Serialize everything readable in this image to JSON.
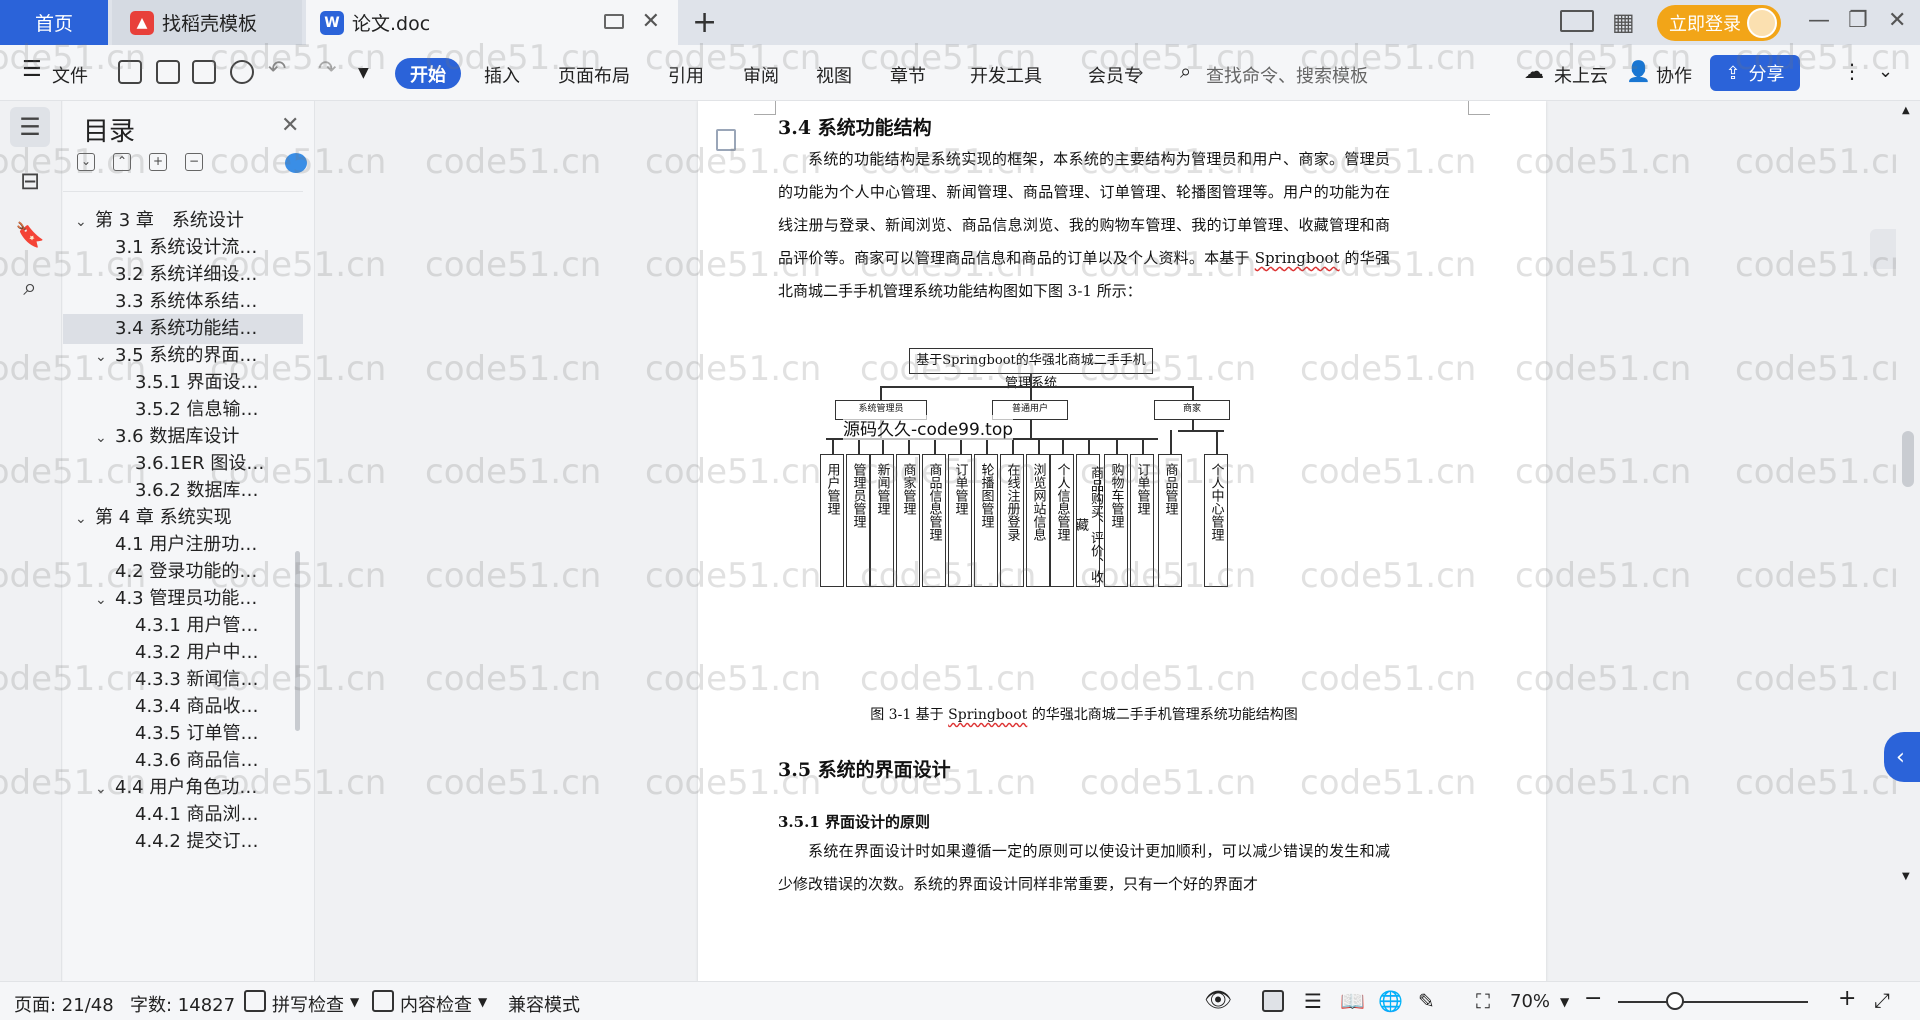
{
  "tabs": {
    "home": "首页",
    "template": "找稻壳模板",
    "document": "论文.doc",
    "new_tab": "+"
  },
  "titlebar": {
    "login": "立即登录"
  },
  "ribbon": {
    "file": "文件",
    "start": "开始",
    "insert": "插入",
    "layout": "页面布局",
    "reference": "引用",
    "review": "审阅",
    "view": "视图",
    "chapter": "章节",
    "devtools": "开发工具",
    "member": "会员专",
    "search_placeholder": "查找命令、搜索模板",
    "cloud": "未上云",
    "collab": "协作",
    "share": "分享"
  },
  "toc": {
    "title": "目录",
    "items": [
      {
        "label": "第 3 章　系统设计",
        "level": 0,
        "expanded": true
      },
      {
        "label": "3.1 系统设计流…",
        "level": 1
      },
      {
        "label": "3.2 系统详细设…",
        "level": 1
      },
      {
        "label": "3.3 系统体系结…",
        "level": 1
      },
      {
        "label": "3.4 系统功能结…",
        "level": 1,
        "selected": true
      },
      {
        "label": "3.5 系统的界面…",
        "level": 1,
        "expanded": true
      },
      {
        "label": "3.5.1 界面设…",
        "level": 2
      },
      {
        "label": "3.5.2 信息输…",
        "level": 2
      },
      {
        "label": "3.6 数据库设计",
        "level": 1,
        "expanded": true
      },
      {
        "label": "3.6.1ER 图设…",
        "level": 2
      },
      {
        "label": "3.6.2 数据库…",
        "level": 2
      },
      {
        "label": "第 4 章 系统实现",
        "level": 0,
        "expanded": true
      },
      {
        "label": "4.1 用户注册功…",
        "level": 1
      },
      {
        "label": "4.2 登录功能的…",
        "level": 1
      },
      {
        "label": "4.3 管理员功能…",
        "level": 1,
        "expanded": true
      },
      {
        "label": "4.3.1 用户管…",
        "level": 2
      },
      {
        "label": "4.3.2 用户中…",
        "level": 2
      },
      {
        "label": "4.3.3 新闻信…",
        "level": 2
      },
      {
        "label": "4.3.4 商品收…",
        "level": 2
      },
      {
        "label": "4.3.5 订单管…",
        "level": 2
      },
      {
        "label": "4.3.6 商品信…",
        "level": 2
      },
      {
        "label": "4.4 用户角色功…",
        "level": 1,
        "expanded": true
      },
      {
        "label": "4.4.1 商品浏…",
        "level": 2
      },
      {
        "label": "4.4.2 提交订…",
        "level": 2
      }
    ]
  },
  "document": {
    "heading_34": "3.4 系统功能结构",
    "para_34_a": "系统的功能结构是系统实现的框架，本系统的主要结构为管理员和用户、商家。管理员的功能为个人中心管理、新闻管理、商品管理、订单管理、轮播图管理等。用户的功能为在线注册与登录、新闻浏览、商品信息浏览、我的购物车管理、我的订单管理、收藏管理和商品评价等。商家可以管理商品信息和商品的订单以及个人资料。本基于 ",
    "para_34_spring": "Springboot",
    "para_34_b": " 的华强北商城二手手机管理系统功能结构图如下图 3-1 所示：",
    "diagram": {
      "root": "基于Springboot的华强北商城二手手机管理系统",
      "groups": [
        "系统管理员",
        "普通用户",
        "商家"
      ],
      "leaves": [
        "用户管理",
        "管理员管理",
        "新闻管理",
        "商家管理",
        "商品信息管理",
        "订单管理",
        "轮播图管理",
        "在线注册登录",
        "浏览网站信息",
        "个人信息管理",
        "商品购买、评价、收藏",
        "购物车管理",
        "订单管理",
        "商品管理",
        "个人中心管理"
      ],
      "stamp": "源码久久-code99.top"
    },
    "caption_a": "图 3-1 基于 ",
    "caption_spring": "Springboot",
    "caption_b": " 的华强北商城二手手机管理系统功能结构图",
    "heading_35": "3.5 系统的界面设计",
    "heading_351": "3.5.1 界面设计的原则",
    "para_351": "系统在界面设计时如果遵循一定的原则可以使设计更加顺利，可以减少错误的发生和减少修改错误的次数。系统的界面设计同样非常重要，只有一个好的界面才"
  },
  "watermark": "code51.cn",
  "status": {
    "page": "页面: 21/48",
    "words": "字数: 14827",
    "spell": "拼写检查",
    "content": "内容检查",
    "compat": "兼容模式",
    "zoom": "70%",
    "zoom_level": 0.3
  }
}
